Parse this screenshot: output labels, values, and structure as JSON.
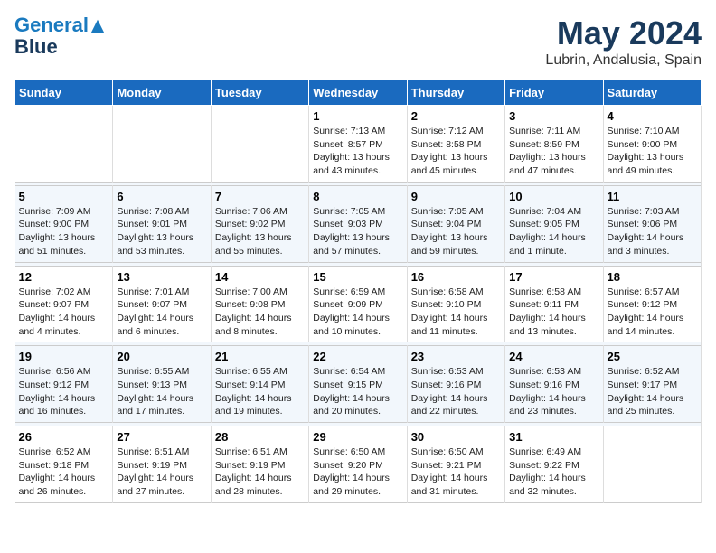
{
  "header": {
    "logo_line1": "General",
    "logo_line2": "Blue",
    "main_title": "May 2024",
    "subtitle": "Lubrin, Andalusia, Spain"
  },
  "days_of_week": [
    "Sunday",
    "Monday",
    "Tuesday",
    "Wednesday",
    "Thursday",
    "Friday",
    "Saturday"
  ],
  "weeks": [
    [
      {
        "day": "",
        "content": ""
      },
      {
        "day": "",
        "content": ""
      },
      {
        "day": "",
        "content": ""
      },
      {
        "day": "1",
        "content": "Sunrise: 7:13 AM\nSunset: 8:57 PM\nDaylight: 13 hours\nand 43 minutes."
      },
      {
        "day": "2",
        "content": "Sunrise: 7:12 AM\nSunset: 8:58 PM\nDaylight: 13 hours\nand 45 minutes."
      },
      {
        "day": "3",
        "content": "Sunrise: 7:11 AM\nSunset: 8:59 PM\nDaylight: 13 hours\nand 47 minutes."
      },
      {
        "day": "4",
        "content": "Sunrise: 7:10 AM\nSunset: 9:00 PM\nDaylight: 13 hours\nand 49 minutes."
      }
    ],
    [
      {
        "day": "5",
        "content": "Sunrise: 7:09 AM\nSunset: 9:00 PM\nDaylight: 13 hours\nand 51 minutes."
      },
      {
        "day": "6",
        "content": "Sunrise: 7:08 AM\nSunset: 9:01 PM\nDaylight: 13 hours\nand 53 minutes."
      },
      {
        "day": "7",
        "content": "Sunrise: 7:06 AM\nSunset: 9:02 PM\nDaylight: 13 hours\nand 55 minutes."
      },
      {
        "day": "8",
        "content": "Sunrise: 7:05 AM\nSunset: 9:03 PM\nDaylight: 13 hours\nand 57 minutes."
      },
      {
        "day": "9",
        "content": "Sunrise: 7:05 AM\nSunset: 9:04 PM\nDaylight: 13 hours\nand 59 minutes."
      },
      {
        "day": "10",
        "content": "Sunrise: 7:04 AM\nSunset: 9:05 PM\nDaylight: 14 hours\nand 1 minute."
      },
      {
        "day": "11",
        "content": "Sunrise: 7:03 AM\nSunset: 9:06 PM\nDaylight: 14 hours\nand 3 minutes."
      }
    ],
    [
      {
        "day": "12",
        "content": "Sunrise: 7:02 AM\nSunset: 9:07 PM\nDaylight: 14 hours\nand 4 minutes."
      },
      {
        "day": "13",
        "content": "Sunrise: 7:01 AM\nSunset: 9:07 PM\nDaylight: 14 hours\nand 6 minutes."
      },
      {
        "day": "14",
        "content": "Sunrise: 7:00 AM\nSunset: 9:08 PM\nDaylight: 14 hours\nand 8 minutes."
      },
      {
        "day": "15",
        "content": "Sunrise: 6:59 AM\nSunset: 9:09 PM\nDaylight: 14 hours\nand 10 minutes."
      },
      {
        "day": "16",
        "content": "Sunrise: 6:58 AM\nSunset: 9:10 PM\nDaylight: 14 hours\nand 11 minutes."
      },
      {
        "day": "17",
        "content": "Sunrise: 6:58 AM\nSunset: 9:11 PM\nDaylight: 14 hours\nand 13 minutes."
      },
      {
        "day": "18",
        "content": "Sunrise: 6:57 AM\nSunset: 9:12 PM\nDaylight: 14 hours\nand 14 minutes."
      }
    ],
    [
      {
        "day": "19",
        "content": "Sunrise: 6:56 AM\nSunset: 9:12 PM\nDaylight: 14 hours\nand 16 minutes."
      },
      {
        "day": "20",
        "content": "Sunrise: 6:55 AM\nSunset: 9:13 PM\nDaylight: 14 hours\nand 17 minutes."
      },
      {
        "day": "21",
        "content": "Sunrise: 6:55 AM\nSunset: 9:14 PM\nDaylight: 14 hours\nand 19 minutes."
      },
      {
        "day": "22",
        "content": "Sunrise: 6:54 AM\nSunset: 9:15 PM\nDaylight: 14 hours\nand 20 minutes."
      },
      {
        "day": "23",
        "content": "Sunrise: 6:53 AM\nSunset: 9:16 PM\nDaylight: 14 hours\nand 22 minutes."
      },
      {
        "day": "24",
        "content": "Sunrise: 6:53 AM\nSunset: 9:16 PM\nDaylight: 14 hours\nand 23 minutes."
      },
      {
        "day": "25",
        "content": "Sunrise: 6:52 AM\nSunset: 9:17 PM\nDaylight: 14 hours\nand 25 minutes."
      }
    ],
    [
      {
        "day": "26",
        "content": "Sunrise: 6:52 AM\nSunset: 9:18 PM\nDaylight: 14 hours\nand 26 minutes."
      },
      {
        "day": "27",
        "content": "Sunrise: 6:51 AM\nSunset: 9:19 PM\nDaylight: 14 hours\nand 27 minutes."
      },
      {
        "day": "28",
        "content": "Sunrise: 6:51 AM\nSunset: 9:19 PM\nDaylight: 14 hours\nand 28 minutes."
      },
      {
        "day": "29",
        "content": "Sunrise: 6:50 AM\nSunset: 9:20 PM\nDaylight: 14 hours\nand 29 minutes."
      },
      {
        "day": "30",
        "content": "Sunrise: 6:50 AM\nSunset: 9:21 PM\nDaylight: 14 hours\nand 31 minutes."
      },
      {
        "day": "31",
        "content": "Sunrise: 6:49 AM\nSunset: 9:22 PM\nDaylight: 14 hours\nand 32 minutes."
      },
      {
        "day": "",
        "content": ""
      }
    ]
  ]
}
